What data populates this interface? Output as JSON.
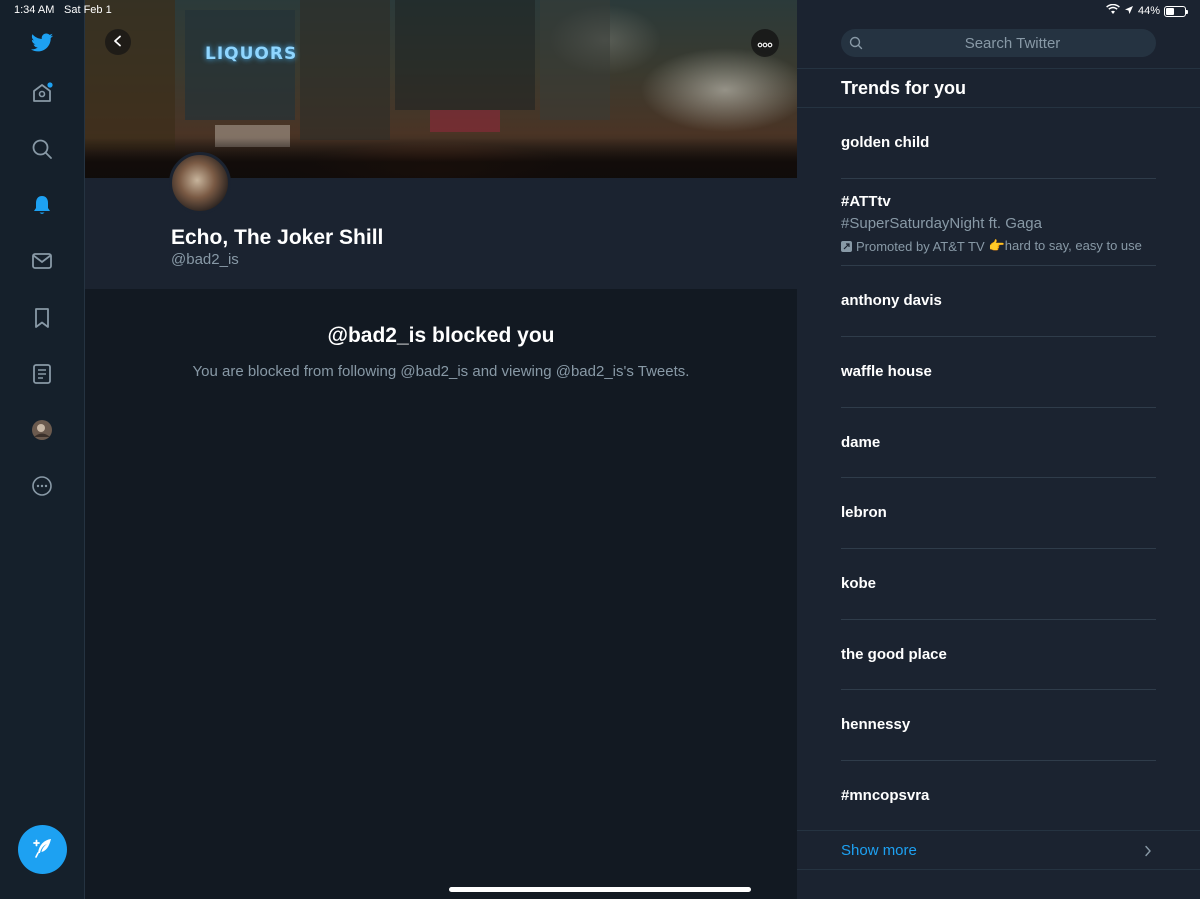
{
  "status_bar": {
    "time": "1:34 AM",
    "date": "Sat Feb 1",
    "battery_percent": "44%",
    "battery_level": 0.44
  },
  "nav": {
    "items": [
      {
        "icon": "twitter-bird-icon"
      },
      {
        "icon": "home-icon",
        "has_notification_dot": true
      },
      {
        "icon": "search-icon"
      },
      {
        "icon": "bell-icon",
        "active": true
      },
      {
        "icon": "mail-icon"
      },
      {
        "icon": "bookmark-icon"
      },
      {
        "icon": "lists-icon"
      },
      {
        "icon": "profile-avatar-icon"
      },
      {
        "icon": "more-icon"
      }
    ],
    "compose_icon": "compose-tweet-icon"
  },
  "profile": {
    "display_name": "Echo, The Joker Shill",
    "handle": "@bad2_is",
    "banner_sign": "LIQUORS"
  },
  "blocked": {
    "title": "@bad2_is blocked you",
    "message": "You are blocked from following @bad2_is and viewing @bad2_is's Tweets."
  },
  "sidebar": {
    "search_placeholder": "Search Twitter",
    "trends_title": "Trends for you",
    "trends": [
      {
        "name": "golden child"
      },
      {
        "name": "#ATTtv",
        "subtitle": "#SuperSaturdayNight ft. Gaga",
        "promoted": "Promoted by AT&T TV",
        "promo_text": "👉hard to say, easy to use"
      },
      {
        "name": "anthony davis"
      },
      {
        "name": "waffle house"
      },
      {
        "name": "dame"
      },
      {
        "name": "lebron"
      },
      {
        "name": "kobe"
      },
      {
        "name": "the good place"
      },
      {
        "name": "hennessy"
      },
      {
        "name": "#mncopsvra"
      }
    ],
    "show_more": "Show more"
  },
  "colors": {
    "accent": "#1da1f2",
    "background": "#15202b",
    "secondary_text": "#8899a6"
  }
}
